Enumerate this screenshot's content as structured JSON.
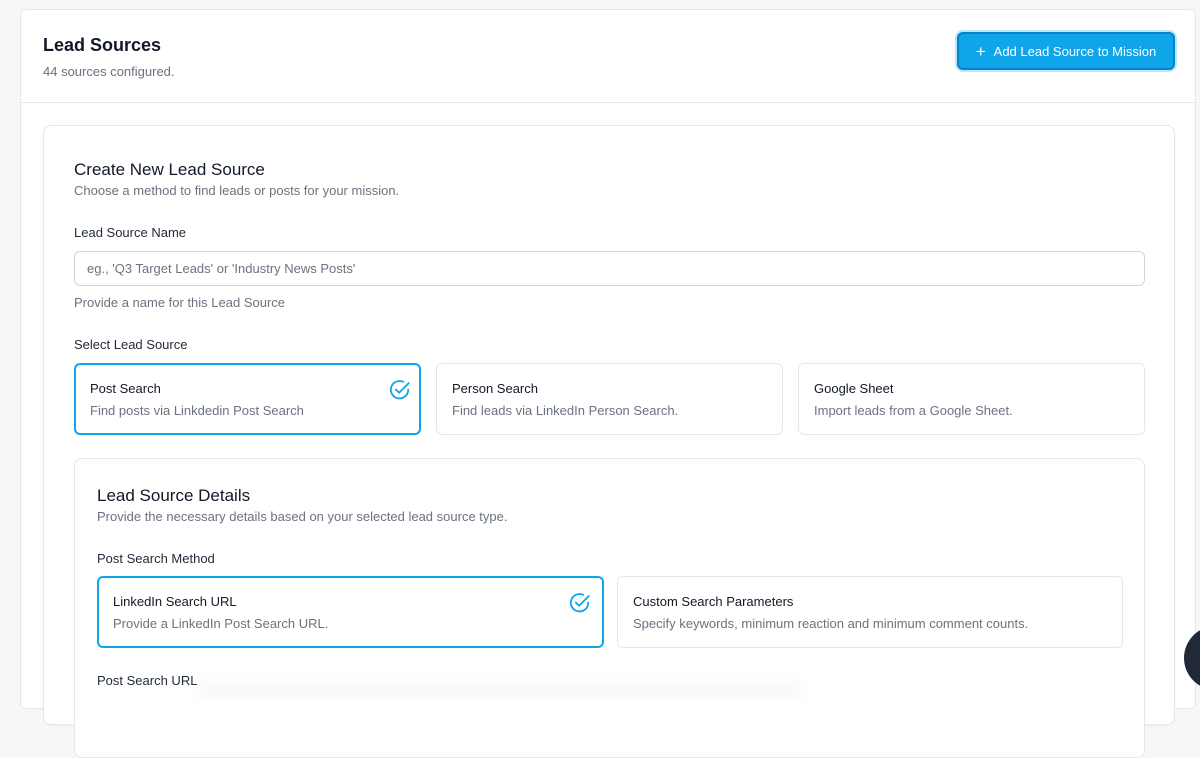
{
  "header": {
    "title": "Lead Sources",
    "subtitle": "44 sources configured.",
    "add_button": {
      "icon": "plus-icon",
      "label": "Add Lead Source to Mission"
    }
  },
  "create": {
    "title": "Create New Lead Source",
    "subtitle": "Choose a method to find leads or posts for your mission.",
    "name_label": "Lead Source Name",
    "name_placeholder": "eg., 'Q3 Target Leads' or 'Industry News Posts'",
    "name_value": "",
    "name_help": "Provide a name for this Lead Source",
    "source_label": "Select Lead Source",
    "sources": [
      {
        "title": "Post Search",
        "desc": "Find posts via Linkdedin Post Search",
        "selected": true
      },
      {
        "title": "Person Search",
        "desc": "Find leads via LinkedIn Person Search.",
        "selected": false
      },
      {
        "title": "Google Sheet",
        "desc": "Import leads from a Google Sheet.",
        "selected": false
      }
    ]
  },
  "details": {
    "title": "Lead Source Details",
    "subtitle": "Provide the necessary details based on your selected lead source type.",
    "method_label": "Post Search Method",
    "methods": [
      {
        "title": "LinkedIn Search URL",
        "desc": "Provide a LinkedIn Post Search URL.",
        "selected": true
      },
      {
        "title": "Custom Search Parameters",
        "desc": "Specify keywords, minimum reaction and minimum comment counts.",
        "selected": false
      }
    ],
    "url_label": "Post Search URL"
  },
  "colors": {
    "accent": "#0ea5e9",
    "accent_dark": "#0284c7",
    "border": "#e5e7eb",
    "muted_text": "#6b7280"
  },
  "icons": {
    "selected": "check-circle-icon"
  }
}
